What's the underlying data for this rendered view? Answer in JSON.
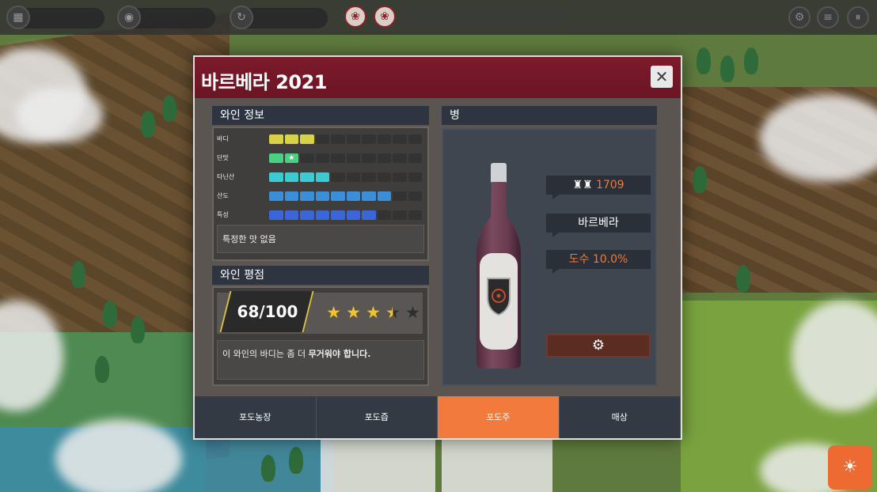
{
  "dialog": {
    "title": "바르베라 2021",
    "close_label": "✕"
  },
  "wine_info": {
    "header": "와인 정보",
    "stats": [
      {
        "label": "바디",
        "filled": 3,
        "total": 10,
        "color": "#d8d24a"
      },
      {
        "label": "단맛",
        "filled": 2,
        "total": 10,
        "color": "#4bcf82"
      },
      {
        "label": "타닌산",
        "filled": 4,
        "total": 10,
        "color": "#3ecad0"
      },
      {
        "label": "산도",
        "filled": 8,
        "total": 10,
        "color": "#3a8fd8"
      },
      {
        "label": "특성",
        "filled": 7,
        "total": 10,
        "color": "#3a66d6"
      }
    ],
    "flavor_note": "특정한 맛 없음"
  },
  "wine_rating": {
    "header": "와인 평점",
    "score": "68/100",
    "stars": 3.5,
    "stars_max": 5,
    "review_prefix": "이 와인의 바디는 좀 더 ",
    "review_bold": "무거워야 합니다."
  },
  "bottle": {
    "header": "병",
    "count": "1709",
    "count_icon": "bottles-icon",
    "variety": "바르베라",
    "abv": "도수 10.0%",
    "action_icon": "gears-icon"
  },
  "tabs": [
    {
      "label": "포도농장",
      "active": false
    },
    {
      "label": "포도즙",
      "active": false
    },
    {
      "label": "포도주",
      "active": true
    },
    {
      "label": "매상",
      "active": false
    }
  ],
  "colors": {
    "header_red": "#7c1a2b",
    "accent_orange": "#f27a3c",
    "star_gold": "#f2c230"
  }
}
